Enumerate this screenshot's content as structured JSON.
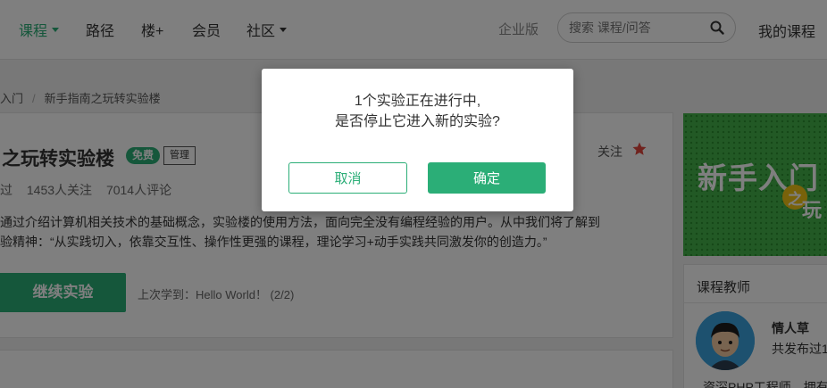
{
  "nav": {
    "items": [
      {
        "label": "课程",
        "has_dropdown": true,
        "active": true
      },
      {
        "label": "路径"
      },
      {
        "label": "楼+"
      },
      {
        "label": "会员"
      },
      {
        "label": "社区",
        "has_dropdown": true
      }
    ],
    "enterprise": "企业版",
    "search_placeholder": "搜索 课程/问答",
    "my_courses": "我的课程"
  },
  "breadcrumb": {
    "items": [
      "入门",
      "新手指南之玩转实验楼"
    ]
  },
  "course": {
    "title": "之玩转实验楼",
    "badge_free": "免费",
    "badge_manage": "管理",
    "follow_label": "关注",
    "stats": [
      "过",
      "1453人关注",
      "7014人评论"
    ],
    "description": [
      "通过介绍计算机相关技术的基础概念，实验楼的使用方法，面向完全没有编程经验的用户。从中我们将了解到",
      "验精神：“从实践切入，依靠交互性、操作性更强的课程，理论学习+动手实践共同激发你的创造力。”"
    ],
    "continue_label": "继续实验",
    "last_learned": "上次学到：Hello World！ (2/2)"
  },
  "sidebar": {
    "banner_text": "新手入门",
    "banner_zhi": "之",
    "banner_wan": "玩",
    "teacher_heading": "课程教师",
    "teacher_name": "情人草",
    "teacher_stat": "共发布过1",
    "teacher_bio": "资深PHP工程师，拥有多"
  },
  "modal": {
    "message_line1": "1个实验正在进行中,",
    "message_line2": "是否停止它进入新的实验?",
    "cancel_label": "取消",
    "confirm_label": "确定"
  },
  "colors": {
    "brand_green": "#2bae77",
    "star_red": "#e0463c",
    "banner_green": "#44b24b",
    "overlay": "rgba(0,0,0,0.5)"
  }
}
